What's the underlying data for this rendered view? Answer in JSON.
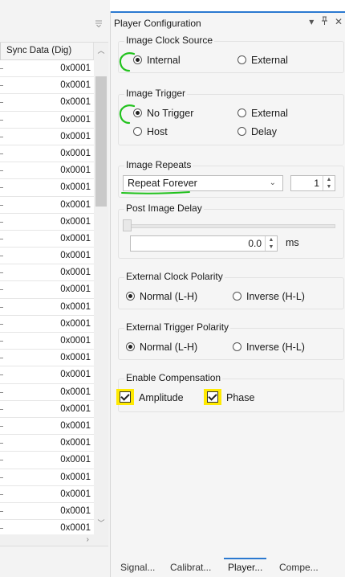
{
  "grid": {
    "column_header": "Sync Data (Dig)",
    "rows": [
      "0x0001",
      "0x0001",
      "0x0001",
      "0x0001",
      "0x0001",
      "0x0001",
      "0x0001",
      "0x0001",
      "0x0001",
      "0x0001",
      "0x0001",
      "0x0001",
      "0x0001",
      "0x0001",
      "0x0001",
      "0x0001",
      "0x0001",
      "0x0001",
      "0x0001",
      "0x0001",
      "0x0001",
      "0x0001",
      "0x0001",
      "0x0001",
      "0x0001",
      "0x0001",
      "0x0001",
      "0x0001"
    ]
  },
  "panel": {
    "title": "Player Configuration",
    "controls": {
      "dropdown": "▾",
      "pin": "ᵖ",
      "close": "✕"
    },
    "image_clock_source": {
      "label": "Image Clock Source",
      "internal": "Internal",
      "external": "External",
      "selected": "Internal"
    },
    "image_trigger": {
      "label": "Image Trigger",
      "no_trigger": "No Trigger",
      "external": "External",
      "host": "Host",
      "delay": "Delay",
      "selected": "No Trigger"
    },
    "image_repeats": {
      "label": "Image Repeats",
      "mode": "Repeat Forever",
      "count": "1"
    },
    "post_image_delay": {
      "label": "Post Image Delay",
      "value": "0.0",
      "unit": "ms"
    },
    "external_clock_polarity": {
      "label": "External Clock Polarity",
      "normal": "Normal (L-H)",
      "inverse": "Inverse (H-L)",
      "selected": "Normal (L-H)"
    },
    "external_trigger_polarity": {
      "label": "External Trigger Polarity",
      "normal": "Normal (L-H)",
      "inverse": "Inverse (H-L)",
      "selected": "Normal (L-H)"
    },
    "enable_compensation": {
      "label": "Enable Compensation",
      "amplitude": "Amplitude",
      "phase": "Phase",
      "amplitude_checked": true,
      "phase_checked": true
    }
  },
  "tabs": [
    "Signal...",
    "Calibrat...",
    "Player...",
    "Compe..."
  ],
  "active_tab": "Player...",
  "colors": {
    "accent": "#2b79d0",
    "highlight": "#ffea00",
    "annotation": "#22c21e"
  }
}
